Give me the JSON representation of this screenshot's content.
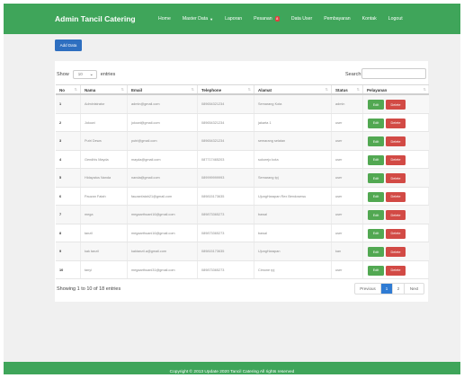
{
  "brand": "Admin Tancil Catering",
  "nav": {
    "home": "Home",
    "master_data": "Master Data",
    "laporan": "Laporan",
    "pesanan": "Pesanan",
    "pesanan_badge": "8",
    "data_user": "Data User",
    "pembayaran": "Pembayaran",
    "kontak": "Kontak",
    "logout": "Logout"
  },
  "add_button": "Add Data",
  "table_controls": {
    "show_label": "Show",
    "entries_value": "10",
    "entries_label": "entries",
    "search_label": "Search:"
  },
  "columns": [
    "No",
    "Nama",
    "Email",
    "Telephone",
    "Alamat",
    "Status",
    "Pelayanan"
  ],
  "rows": [
    {
      "no": "1",
      "nama": "Administrator",
      "email": "admin@gmail.com",
      "telephone": "089654321234",
      "alamat": "Semarang Kota",
      "status": "admin"
    },
    {
      "no": "2",
      "nama": "Jokowi",
      "email": "jokowi@gmail.com",
      "telephone": "089654321234",
      "alamat": "jakarta 1",
      "status": "user"
    },
    {
      "no": "3",
      "nama": "Putri Dewa",
      "email": "putri@gmail.com",
      "telephone": "089654321234",
      "alamat": "semarang selatan",
      "status": "user"
    },
    {
      "no": "4",
      "nama": "Gendhis Mayda",
      "email": "mayda@gmail.com",
      "telephone": "087717465203",
      "alamat": "sukorejo kota",
      "status": "user"
    },
    {
      "no": "5",
      "nama": "Hidayatus Nanda",
      "email": "nanda@gmail.com",
      "telephone": "089999999993",
      "alamat": "Semarang tpj",
      "status": "user"
    },
    {
      "no": "6",
      "nama": "Pauzan Fatah",
      "email": "fauzanfatah21@gmail.com",
      "telephone": "089815173635",
      "alamat": "UjungHarapan Rex Bendosewu",
      "status": "user"
    },
    {
      "no": "7",
      "nama": "mega",
      "email": "megaarthuani16@gmail.com",
      "telephone": "089873365273",
      "alamat": "bawal",
      "status": "user"
    },
    {
      "no": "8",
      "nama": "tanzil",
      "email": "megaarthuani16@gmail.com",
      "telephone": "089873365273",
      "alamat": "bawal",
      "status": "user"
    },
    {
      "no": "9",
      "nama": "kak tanzil",
      "email": "kaktanzil.a@gmail.com",
      "telephone": "089815173635",
      "alamat": "UjungHarapan",
      "status": "kan"
    },
    {
      "no": "10",
      "nama": "tanyi",
      "email": "megaarthuani31@gmail.com",
      "telephone": "089873365273",
      "alamat": "Cimone rpj",
      "status": "user"
    }
  ],
  "row_actions": {
    "edit": "Edit",
    "delete": "Delete"
  },
  "info": "Showing 1 to 10 of 18 entries",
  "pagination": {
    "previous": "Previous",
    "pages": [
      "1",
      "2"
    ],
    "active_page": "1",
    "next": "Next"
  },
  "footer": "Copyright © 2013 Update 2020 Tancil Catering All rights reserved",
  "colors": {
    "primary_green": "#3fa55a",
    "add_blue": "#2e6fc0",
    "edit_green": "#52a852",
    "delete_red": "#d24a45",
    "page_active": "#2f7bd3"
  },
  "icons": {
    "dropdown": "caret-down-icon",
    "sort": "sort-arrows-icon",
    "select": "chevron-down-icon"
  }
}
